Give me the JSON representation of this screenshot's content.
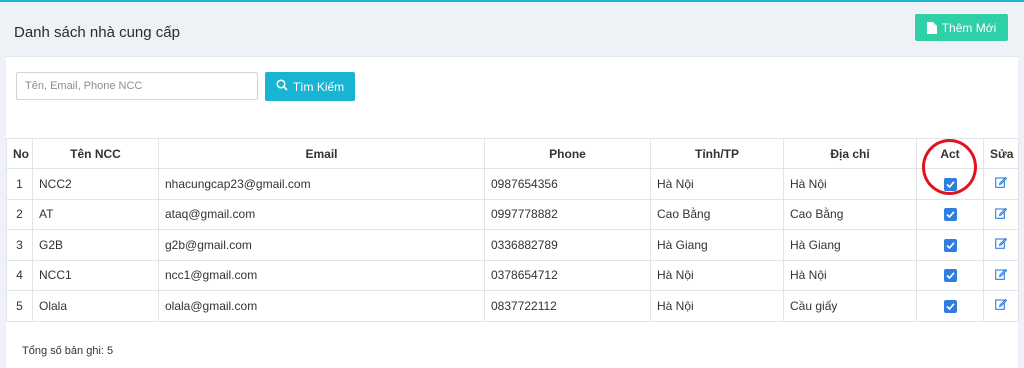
{
  "header": {
    "title": "Danh sách nhà cung cấp",
    "add_label": "Thêm Mới"
  },
  "search": {
    "placeholder": "Tên, Email, Phone NCC",
    "button_label": "Tìm Kiếm"
  },
  "table": {
    "columns": [
      "No",
      "Tên NCC",
      "Email",
      "Phone",
      "Tỉnh/TP",
      "Địa chỉ",
      "Act",
      "Sửa"
    ],
    "rows": [
      {
        "no": "1",
        "name": "NCC2",
        "email": "nhacungcap23@gmail.com",
        "phone": "0987654356",
        "province": "Hà Nội",
        "address": "Hà Nội",
        "act": true
      },
      {
        "no": "2",
        "name": "AT",
        "email": "ataq@gmail.com",
        "phone": "0997778882",
        "province": "Cao Bằng",
        "address": "Cao Bằng",
        "act": true
      },
      {
        "no": "3",
        "name": "G2B",
        "email": "g2b@gmail.com",
        "phone": "0336882789",
        "province": "Hà Giang",
        "address": "Hà Giang",
        "act": true
      },
      {
        "no": "4",
        "name": "NCC1",
        "email": "ncc1@gmail.com",
        "phone": "0378654712",
        "province": "Hà Nội",
        "address": "Hà Nội",
        "act": true
      },
      {
        "no": "5",
        "name": "Olala",
        "email": "olala@gmail.com",
        "phone": "0837722112",
        "province": "Hà Nội",
        "address": "Cầu giấy",
        "act": true
      }
    ]
  },
  "footer": {
    "total_label": "Tổng số bản ghi: 5"
  },
  "icons": {
    "add": "file-icon",
    "search": "search-icon",
    "checkbox": "checkbox-checked-icon",
    "edit": "edit-icon"
  },
  "colors": {
    "add_button": "#2fcfa7",
    "search_button": "#17b5d3",
    "checkbox": "#2f7de1",
    "highlight_ring": "#e0141e"
  }
}
